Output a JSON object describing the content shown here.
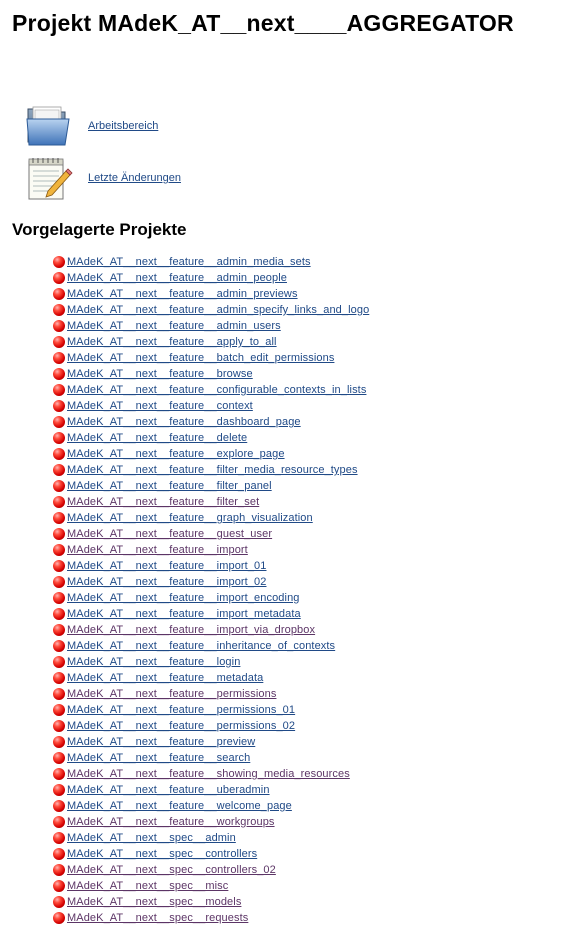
{
  "page": {
    "title": "Projekt MAdeK_AT__next____AGGREGATOR"
  },
  "tasks": [
    {
      "label": "Arbeitsbereich",
      "icon": "folder-icon"
    },
    {
      "label": "Letzte Änderungen",
      "icon": "notepad-icon"
    }
  ],
  "upstream": {
    "heading": "Vorgelagerte Projekte",
    "status_icon": "red-ball-icon",
    "colors": {
      "link": "#204a87",
      "visited": "#5c3566",
      "status_failed": "#d40000"
    },
    "projects": [
      {
        "name": "MAdeK_AT__next__feature__admin_media_sets",
        "visited": false
      },
      {
        "name": "MAdeK_AT__next__feature__admin_people",
        "visited": false
      },
      {
        "name": "MAdeK_AT__next__feature__admin_previews",
        "visited": false
      },
      {
        "name": "MAdeK_AT__next__feature__admin_specify_links_and_logo",
        "visited": false
      },
      {
        "name": "MAdeK_AT__next__feature__admin_users",
        "visited": false
      },
      {
        "name": "MAdeK_AT__next__feature__apply_to_all",
        "visited": false
      },
      {
        "name": "MAdeK_AT__next__feature__batch_edit_permissions",
        "visited": false
      },
      {
        "name": "MAdeK_AT__next__feature__browse",
        "visited": false
      },
      {
        "name": "MAdeK_AT__next__feature__configurable_contexts_in_lists",
        "visited": false
      },
      {
        "name": "MAdeK_AT__next__feature__context",
        "visited": false
      },
      {
        "name": "MAdeK_AT__next__feature__dashboard_page",
        "visited": false
      },
      {
        "name": "MAdeK_AT__next__feature__delete",
        "visited": false
      },
      {
        "name": "MAdeK_AT__next__feature__explore_page",
        "visited": false
      },
      {
        "name": "MAdeK_AT__next__feature__filter_media_resource_types",
        "visited": false
      },
      {
        "name": "MAdeK_AT__next__feature__filter_panel",
        "visited": false
      },
      {
        "name": "MAdeK_AT__next__feature__filter_set",
        "visited": true
      },
      {
        "name": "MAdeK_AT__next__feature__graph_visualization",
        "visited": false
      },
      {
        "name": "MAdeK_AT__next__feature__guest_user",
        "visited": true
      },
      {
        "name": "MAdeK_AT__next__feature__import",
        "visited": true
      },
      {
        "name": "MAdeK_AT__next__feature__import_01",
        "visited": false
      },
      {
        "name": "MAdeK_AT__next__feature__import_02",
        "visited": false
      },
      {
        "name": "MAdeK_AT__next__feature__import_encoding",
        "visited": false
      },
      {
        "name": "MAdeK_AT__next__feature__import_metadata",
        "visited": false
      },
      {
        "name": "MAdeK_AT__next__feature__import_via_dropbox",
        "visited": true
      },
      {
        "name": "MAdeK_AT__next__feature__inheritance_of_contexts",
        "visited": false
      },
      {
        "name": "MAdeK_AT__next__feature__login",
        "visited": false
      },
      {
        "name": "MAdeK_AT__next__feature__metadata",
        "visited": false
      },
      {
        "name": "MAdeK_AT__next__feature__permissions",
        "visited": true
      },
      {
        "name": "MAdeK_AT__next__feature__permissions_01",
        "visited": false
      },
      {
        "name": "MAdeK_AT__next__feature__permissions_02",
        "visited": false
      },
      {
        "name": "MAdeK_AT__next__feature__preview",
        "visited": false
      },
      {
        "name": "MAdeK_AT__next__feature__search",
        "visited": false
      },
      {
        "name": "MAdeK_AT__next__feature__showing_media_resources",
        "visited": true
      },
      {
        "name": "MAdeK_AT__next__feature__uberadmin",
        "visited": false
      },
      {
        "name": "MAdeK_AT__next__feature__welcome_page",
        "visited": false
      },
      {
        "name": "MAdeK_AT__next__feature__workgroups",
        "visited": true
      },
      {
        "name": "MAdeK_AT__next__spec__admin",
        "visited": false
      },
      {
        "name": "MAdeK_AT__next__spec__controllers",
        "visited": false
      },
      {
        "name": "MAdeK_AT__next__spec__controllers_02",
        "visited": true
      },
      {
        "name": "MAdeK_AT__next__spec__misc",
        "visited": true
      },
      {
        "name": "MAdeK_AT__next__spec__models",
        "visited": true
      },
      {
        "name": "MAdeK_AT__next__spec__requests",
        "visited": true
      }
    ]
  }
}
